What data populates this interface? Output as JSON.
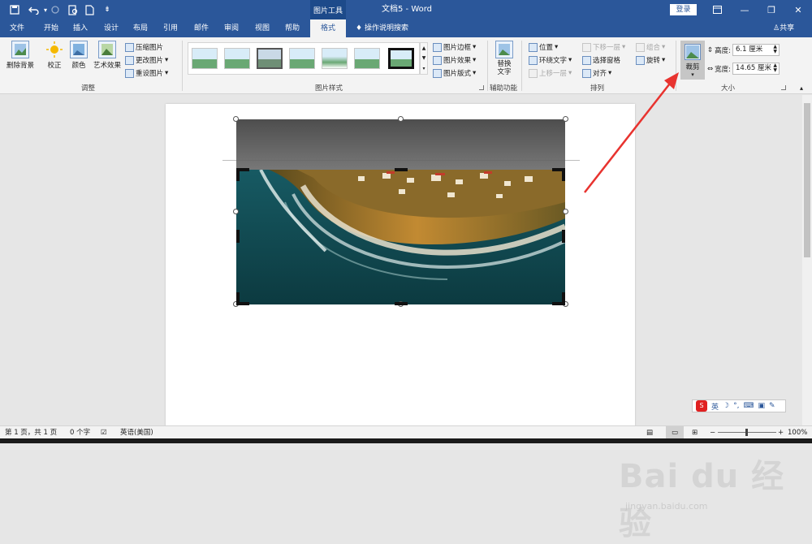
{
  "window": {
    "context_group": "图片工具",
    "title": "文档5 - Word",
    "login_label": "登录"
  },
  "qat": {
    "save_icon": "save-icon",
    "undo_icon": "undo-icon",
    "redo_icon": "redo-icon",
    "print_preview_icon": "print-preview-icon",
    "new_doc_icon": "new-document-icon",
    "customize_icon": "customize-qat-icon"
  },
  "tabs": [
    "文件",
    "开始",
    "插入",
    "设计",
    "布局",
    "引用",
    "邮件",
    "审阅",
    "视图",
    "帮助",
    "格式"
  ],
  "active_tab": "格式",
  "tell_me": "操作说明搜索",
  "share": "共享",
  "ribbon": {
    "adjust": {
      "remove_bg": "删除背景",
      "corrections": "校正",
      "color": "颜色",
      "artistic": "艺术效果",
      "compress": "压缩图片",
      "change": "更改图片",
      "reset": "重设图片",
      "group_label": "调整"
    },
    "styles": {
      "border": "图片边框",
      "effects": "图片效果",
      "layout": "图片版式",
      "group_label": "图片样式"
    },
    "accessibility": {
      "alt_text": "替换文字",
      "group_label": "辅助功能"
    },
    "arrange": {
      "position": "位置",
      "wrap": "环绕文字",
      "forward": "上移一层",
      "backward": "下移一层",
      "selection_pane": "选择窗格",
      "align": "对齐",
      "group": "组合",
      "rotate": "旋转",
      "group_label": "排列"
    },
    "size": {
      "crop": "裁剪",
      "height_label": "高度:",
      "height_value": "6.1 厘米",
      "width_label": "宽度:",
      "width_value": "14.65 厘米",
      "group_label": "大小"
    }
  },
  "status": {
    "page": "第 1 页，共 1 页",
    "words": "0 个字",
    "language": "英语(美国)",
    "zoom": "100%"
  },
  "watermark": {
    "main": "Bai du 经验",
    "url": "jingyan.baidu.com"
  },
  "ime": {
    "lang": "英"
  },
  "colors": {
    "word_blue": "#2b579a",
    "arrow_red": "#e8332f"
  }
}
